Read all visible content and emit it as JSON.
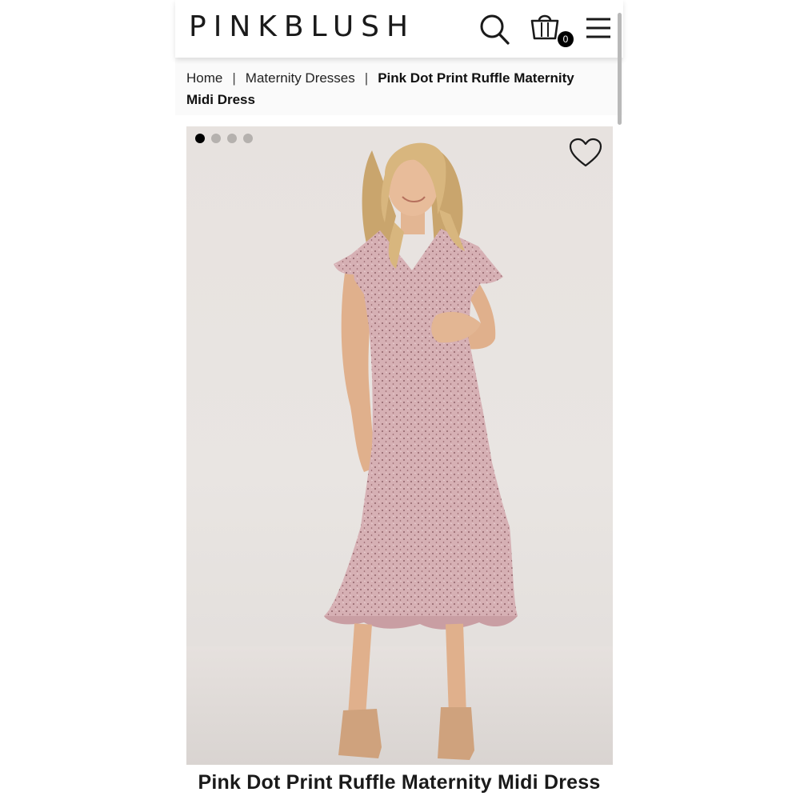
{
  "header": {
    "logo": "PINKBLUSH",
    "search_icon": "search-icon",
    "cart_icon": "shopping-bag-icon",
    "cart_count": "0",
    "menu_icon": "hamburger-menu-icon"
  },
  "breadcrumb": {
    "items": [
      "Home",
      "Maternity Dresses"
    ],
    "separator": "|",
    "current": "Pink Dot Print Ruffle Maternity Midi Dress"
  },
  "gallery": {
    "image_count": 4,
    "active_index": 0,
    "favorite_icon": "heart-outline-icon"
  },
  "product": {
    "title": "Pink Dot Print Ruffle Maternity Midi Dress"
  },
  "colors": {
    "dress": "#d4aeb2",
    "background": "#e7e2df",
    "accent": "#000000"
  }
}
